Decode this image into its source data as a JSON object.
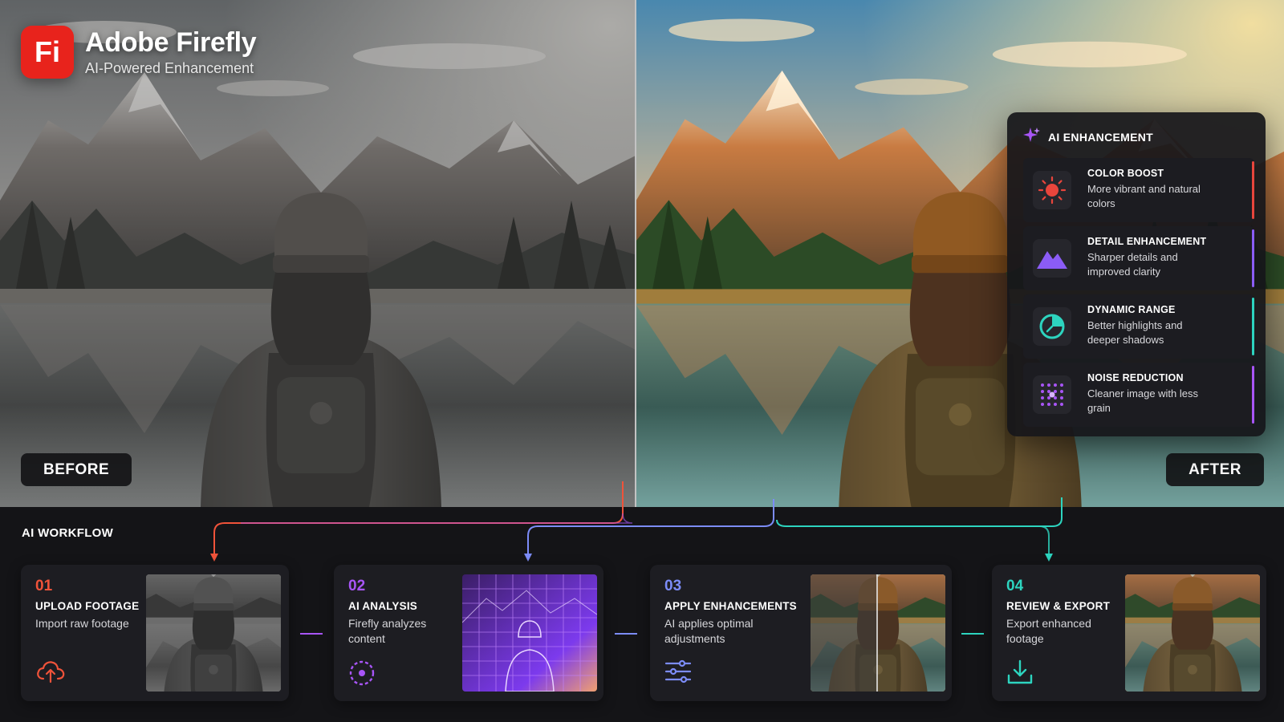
{
  "brand": {
    "logo_text": "Fi",
    "name": "Adobe Firefly",
    "subtitle": "AI-Powered Enhancement"
  },
  "comparison": {
    "before_label": "BEFORE",
    "after_label": "AFTER"
  },
  "enhancement_panel": {
    "title": "AI ENHANCEMENT",
    "icon": "sparkle-icon",
    "items": [
      {
        "title": "COLOR BOOST",
        "desc": "More vibrant and natural colors",
        "icon": "sun-icon",
        "accent": "#e8453c"
      },
      {
        "title": "DETAIL ENHANCEMENT",
        "desc": "Sharper details and improved clarity",
        "icon": "mountain-icon",
        "accent": "#8b5cf6"
      },
      {
        "title": "DYNAMIC RANGE",
        "desc": "Better highlights and deeper shadows",
        "icon": "dial-icon",
        "accent": "#2dd4bf"
      },
      {
        "title": "NOISE REDUCTION",
        "desc": "Cleaner image with less grain",
        "icon": "dots-grid-icon",
        "accent": "#a855f7"
      }
    ]
  },
  "workflow": {
    "title": "AI WORKFLOW",
    "steps": [
      {
        "num": "01",
        "title": "UPLOAD FOOTAGE",
        "desc": "Import raw footage",
        "icon": "cloud-upload-icon",
        "color": "#f0533a"
      },
      {
        "num": "02",
        "title": "AI ANALYSIS",
        "desc": "Firefly analyzes content",
        "icon": "scan-ring-icon",
        "color": "#a855f7"
      },
      {
        "num": "03",
        "title": "APPLY ENHANCEMENTS",
        "desc": "AI applies optimal adjustments",
        "icon": "sliders-icon",
        "color": "#7c8cf8"
      },
      {
        "num": "04",
        "title": "REVIEW & EXPORT",
        "desc": "Export enhanced footage",
        "icon": "download-icon",
        "color": "#2dd4bf"
      }
    ]
  },
  "colors": {
    "brand_red": "#e8231c",
    "panel_bg": "#16161a",
    "accent_purple": "#8b5cf6",
    "accent_teal": "#2dd4bf"
  }
}
